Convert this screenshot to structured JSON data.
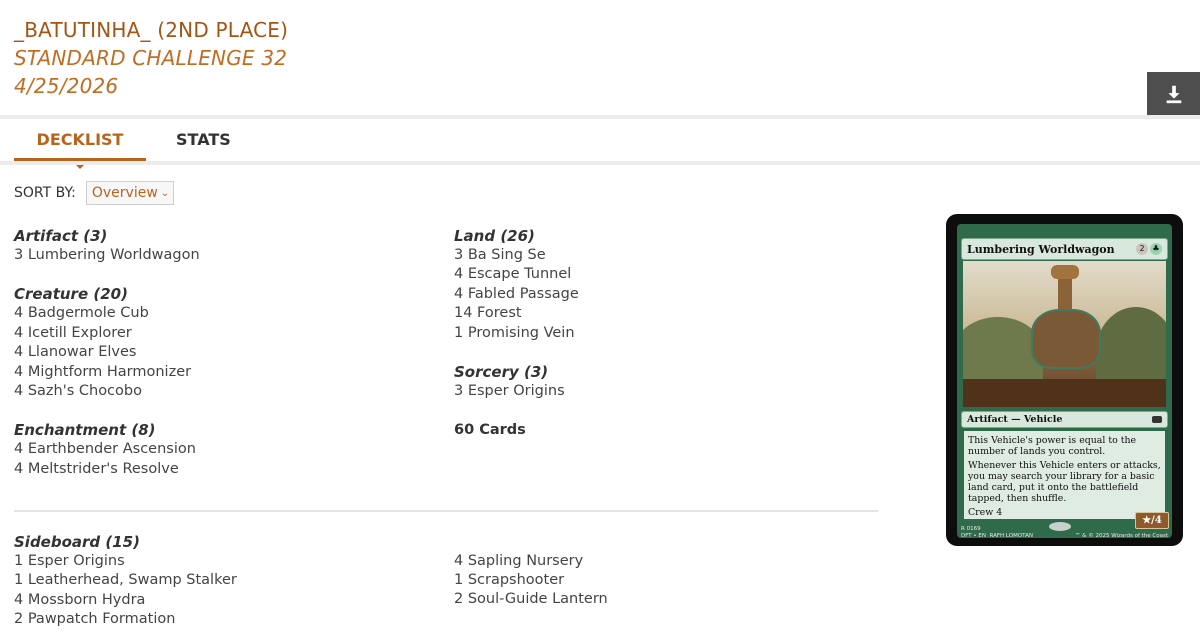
{
  "header": {
    "title": "_BATUTINHA_ (2ND PLACE)",
    "event": "STANDARD CHALLENGE 32",
    "date": "4/25/2026"
  },
  "download": {
    "icon": "download-icon"
  },
  "tabs": [
    {
      "label": "DECKLIST",
      "active": true
    },
    {
      "label": "STATS",
      "active": false
    }
  ],
  "sort": {
    "label": "SORT BY:",
    "selected": "Overview"
  },
  "decklist": {
    "left": [
      {
        "heading": "Artifact (3)",
        "cards": [
          "3 Lumbering Worldwagon"
        ]
      },
      {
        "heading": "Creature (20)",
        "cards": [
          "4 Badgermole Cub",
          "4 Icetill Explorer",
          "4 Llanowar Elves",
          "4 Mightform Harmonizer",
          "4 Sazh's Chocobo"
        ]
      },
      {
        "heading": "Enchantment (8)",
        "cards": [
          "4 Earthbender Ascension",
          "4 Meltstrider's Resolve"
        ]
      }
    ],
    "right": [
      {
        "heading": "Land (26)",
        "cards": [
          "3 Ba Sing Se",
          "4 Escape Tunnel",
          "4 Fabled Passage",
          "14 Forest",
          "1 Promising Vein"
        ]
      },
      {
        "heading": "Sorcery (3)",
        "cards": [
          "3 Esper Origins"
        ]
      }
    ],
    "total": "60 Cards"
  },
  "sideboard": {
    "heading": "Sideboard (15)",
    "left": [
      "1 Esper Origins",
      "1 Leatherhead, Swamp Stalker",
      "4 Mossborn Hydra",
      "2 Pawpatch Formation"
    ],
    "right": [
      "4 Sapling Nursery",
      "1 Scrapshooter",
      "2 Soul-Guide Lantern"
    ]
  },
  "card_preview": {
    "name": "Lumbering Worldwagon",
    "mana_generic": "2",
    "type_line": "Artifact — Vehicle",
    "rules": [
      "This Vehicle's power is equal to the number of lands you control.",
      "Whenever this Vehicle enters or attacks, you may search your library for a basic land card, put it onto the battlefield tapped, then shuffle.",
      "Crew 4"
    ],
    "pt": "★/4",
    "footer_left": "R 0169\nDFT • EN  RAFH LOMOTAN",
    "footer_right": "™ & © 2025 Wizards of the Coast"
  },
  "colors": {
    "accent": "#b8651c",
    "text": "#333333",
    "download_bg": "#4e4e4e"
  }
}
